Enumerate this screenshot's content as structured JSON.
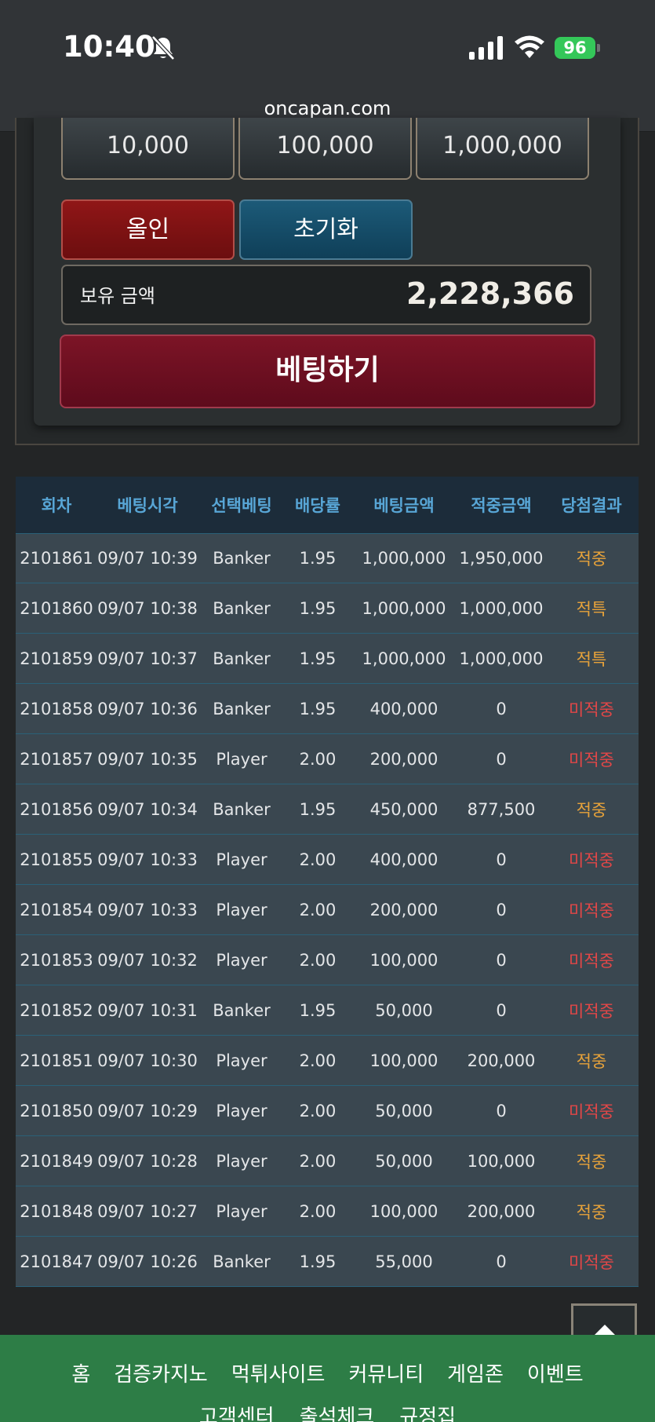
{
  "status": {
    "time": "10:40",
    "battery": "96"
  },
  "browser": {
    "url": "oncapan.com"
  },
  "bet_panel": {
    "chips": [
      "10,000",
      "100,000",
      "1,000,000"
    ],
    "allin_label": "올인",
    "reset_label": "초기화",
    "balance_label": "보유 금액",
    "balance_value": "2,228,366",
    "bet_button_label": "베팅하기"
  },
  "history": {
    "headers": [
      "회차",
      "베팅시각",
      "선택베팅",
      "배당률",
      "베팅금액",
      "적중금액",
      "당첨결과"
    ],
    "rows": [
      {
        "round": "2101861",
        "time": "09/07 10:39",
        "pick": "Banker",
        "odds": "1.95",
        "bet": "1,000,000",
        "payout": "1,950,000",
        "result": "적중",
        "win": true
      },
      {
        "round": "2101860",
        "time": "09/07 10:38",
        "pick": "Banker",
        "odds": "1.95",
        "bet": "1,000,000",
        "payout": "1,000,000",
        "result": "적특",
        "win": true
      },
      {
        "round": "2101859",
        "time": "09/07 10:37",
        "pick": "Banker",
        "odds": "1.95",
        "bet": "1,000,000",
        "payout": "1,000,000",
        "result": "적특",
        "win": true
      },
      {
        "round": "2101858",
        "time": "09/07 10:36",
        "pick": "Banker",
        "odds": "1.95",
        "bet": "400,000",
        "payout": "0",
        "result": "미적중",
        "win": false
      },
      {
        "round": "2101857",
        "time": "09/07 10:35",
        "pick": "Player",
        "odds": "2.00",
        "bet": "200,000",
        "payout": "0",
        "result": "미적중",
        "win": false
      },
      {
        "round": "2101856",
        "time": "09/07 10:34",
        "pick": "Banker",
        "odds": "1.95",
        "bet": "450,000",
        "payout": "877,500",
        "result": "적중",
        "win": true
      },
      {
        "round": "2101855",
        "time": "09/07 10:33",
        "pick": "Player",
        "odds": "2.00",
        "bet": "400,000",
        "payout": "0",
        "result": "미적중",
        "win": false
      },
      {
        "round": "2101854",
        "time": "09/07 10:33",
        "pick": "Player",
        "odds": "2.00",
        "bet": "200,000",
        "payout": "0",
        "result": "미적중",
        "win": false
      },
      {
        "round": "2101853",
        "time": "09/07 10:32",
        "pick": "Player",
        "odds": "2.00",
        "bet": "100,000",
        "payout": "0",
        "result": "미적중",
        "win": false
      },
      {
        "round": "2101852",
        "time": "09/07 10:31",
        "pick": "Banker",
        "odds": "1.95",
        "bet": "50,000",
        "payout": "0",
        "result": "미적중",
        "win": false
      },
      {
        "round": "2101851",
        "time": "09/07 10:30",
        "pick": "Player",
        "odds": "2.00",
        "bet": "100,000",
        "payout": "200,000",
        "result": "적중",
        "win": true
      },
      {
        "round": "2101850",
        "time": "09/07 10:29",
        "pick": "Player",
        "odds": "2.00",
        "bet": "50,000",
        "payout": "0",
        "result": "미적중",
        "win": false
      },
      {
        "round": "2101849",
        "time": "09/07 10:28",
        "pick": "Player",
        "odds": "2.00",
        "bet": "50,000",
        "payout": "100,000",
        "result": "적중",
        "win": true
      },
      {
        "round": "2101848",
        "time": "09/07 10:27",
        "pick": "Player",
        "odds": "2.00",
        "bet": "100,000",
        "payout": "200,000",
        "result": "적중",
        "win": true
      },
      {
        "round": "2101847",
        "time": "09/07 10:26",
        "pick": "Banker",
        "odds": "1.95",
        "bet": "55,000",
        "payout": "0",
        "result": "미적중",
        "win": false
      }
    ]
  },
  "footer": {
    "row1": [
      "홈",
      "검증카지노",
      "먹튀사이트",
      "커뮤니티",
      "게임존",
      "이벤트"
    ],
    "row2": [
      "고객센터",
      "출석체크",
      "규정집"
    ]
  },
  "colors": {
    "win": "#e8a33a",
    "lose": "#e24747",
    "header": "#58a6d6",
    "footer": "#2d7d46"
  },
  "icons": [
    "bell-slash-icon",
    "signal-icon",
    "wifi-icon",
    "battery-icon",
    "arrow-up-icon"
  ]
}
